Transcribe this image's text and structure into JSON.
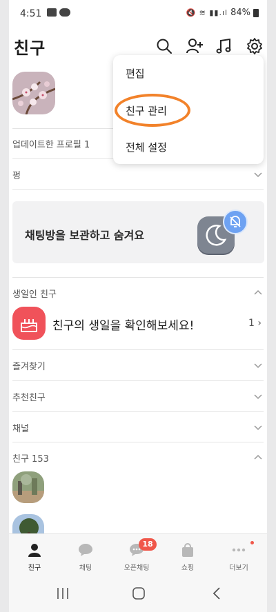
{
  "status": {
    "time": "4:51",
    "battery": "84%"
  },
  "header": {
    "title": "친구"
  },
  "rows": {
    "updated_profile": "업데이트한 프로필 1",
    "pyeong": "펑",
    "birthday_section": "생일인 친구",
    "birthday_cta": "친구의 생일을 확인해보세요!",
    "birthday_count": "1",
    "favorites": "즐겨찾기",
    "recommended": "추천친구",
    "channel": "채널",
    "friends_header": "친구 153"
  },
  "banner": {
    "text": "채팅방을 보관하고 숨겨요"
  },
  "menu": {
    "items": [
      "편집",
      "친구 관리",
      "전체 설정"
    ]
  },
  "bottom_nav": {
    "items": [
      {
        "label": "친구",
        "icon": "person-icon",
        "active": true
      },
      {
        "label": "채팅",
        "icon": "chat-bubble-icon"
      },
      {
        "label": "오픈채팅",
        "icon": "open-chat-icon",
        "badge": "18"
      },
      {
        "label": "쇼핑",
        "icon": "shopping-bag-icon"
      },
      {
        "label": "더보기",
        "icon": "more-icon",
        "dot": true
      }
    ]
  },
  "colors": {
    "accent_highlight": "#f2822a",
    "badge": "#f0574a",
    "bday_icon": "#f0525a",
    "bell": "#6ea2f2"
  }
}
